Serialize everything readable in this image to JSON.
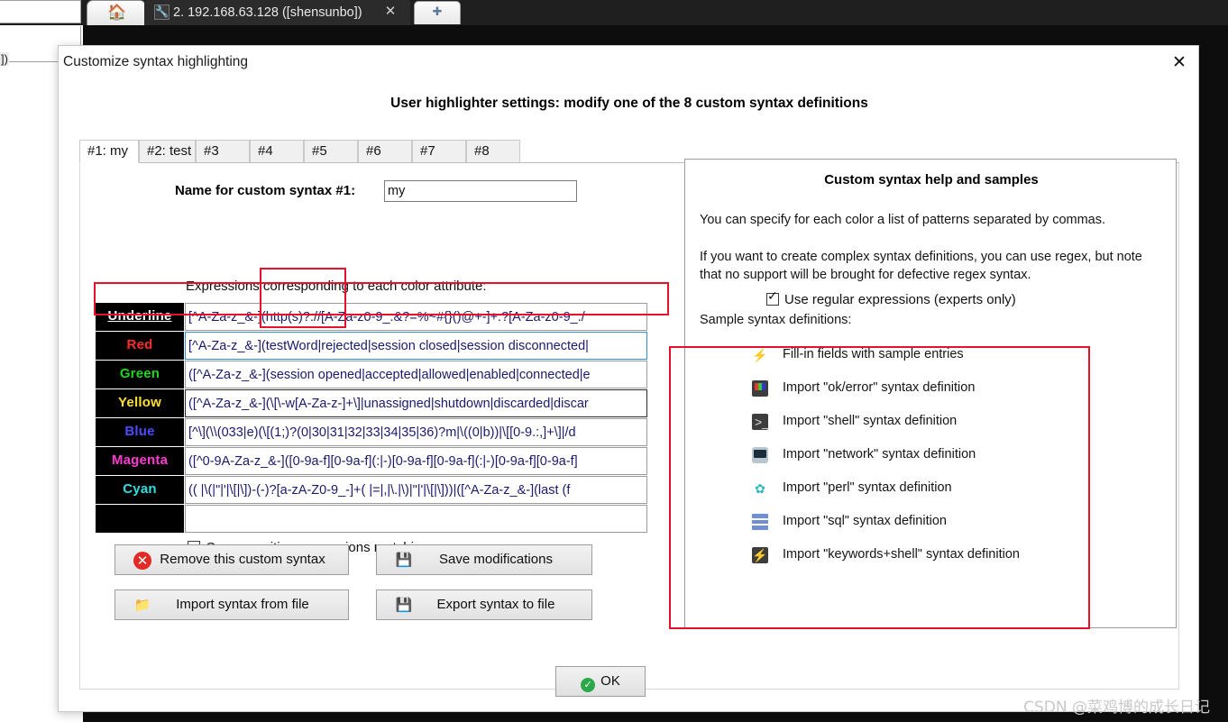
{
  "background_app": {
    "home_tab_icon": "home-icon",
    "terminal_tab": {
      "icon": "wrench-icon",
      "label": "2. 192.168.63.128 ([shensunbo])",
      "close_icon": "close-icon"
    },
    "new_tab_icon": "plus-icon",
    "side_text": "])"
  },
  "dialog": {
    "title": "Customize syntax highlighting",
    "close_icon": "close-icon",
    "heading": "User highlighter settings: modify one of the 8 custom syntax definitions",
    "tabs": [
      {
        "label": "#1: my",
        "active": true
      },
      {
        "label": "#2: test",
        "active": false
      },
      {
        "label": "#3",
        "active": false
      },
      {
        "label": "#4",
        "active": false
      },
      {
        "label": "#5",
        "active": false
      },
      {
        "label": "#6",
        "active": false
      },
      {
        "label": "#7",
        "active": false
      },
      {
        "label": "#8",
        "active": false
      }
    ],
    "name_field": {
      "label": "Name for custom syntax #1:",
      "value": "my",
      "placeholder": ""
    },
    "expressions_caption": "Expressions corresponding to each color attribute:",
    "rows": [
      {
        "attribute": "Underline",
        "color": "#ffffff",
        "underlined": true,
        "value": "[^A-Za-z_&-](http(s)?://[A-Za-z0-9_.&?=%~#{}()@+-]+:?[A-Za-z0-9_./"
      },
      {
        "attribute": "Red",
        "color": "#ff2b2b",
        "underlined": false,
        "focused": true,
        "value": "[^A-Za-z_&-](testWord|rejected|session closed|session disconnected|"
      },
      {
        "attribute": "Green",
        "color": "#21d421",
        "underlined": false,
        "value": "([^A-Za-z_&-](session opened|accepted|allowed|enabled|connected|e"
      },
      {
        "attribute": "Yellow",
        "color": "#ffe12b",
        "underlined": false,
        "value": "([^A-Za-z_&-](\\[\\-w[A-Za-z-]+\\]|unassigned|shutdown|discarded|discar"
      },
      {
        "attribute": "Blue",
        "color": "#4b4bff",
        "underlined": false,
        "value": "[^\\](\\\\(033|e)(\\[(1;)?(0|30|31|32|33|34|35|36)?m|\\((0|b))|\\[[0-9.:,]+\\]|/d"
      },
      {
        "attribute": "Magenta",
        "color": "#ff3ad0",
        "underlined": false,
        "value": "([^0-9A-Za-z_&-]([0-9a-f][0-9a-f](:|-)[0-9a-f][0-9a-f](:|-)[0-9a-f][0-9a-f]"
      },
      {
        "attribute": "Cyan",
        "color": "#2be0e0",
        "underlined": false,
        "value": "(( |\\(|\"|'|\\[|\\])-(-)?[a-zA-Z0-9_-]+( |=|,|\\.|\\)|\"|'|\\[|\\]))|([^A-Za-z_&-](last (f"
      },
      {
        "attribute": "",
        "color": "#ffffff",
        "underlined": false,
        "value": ""
      }
    ],
    "case_sensitive": {
      "label": "Case-sensitive expressions matching",
      "checked": false
    },
    "buttons": [
      {
        "id": "remove",
        "label": "Remove this custom syntax",
        "icon": "x-circle-icon"
      },
      {
        "id": "save",
        "label": "Save modifications",
        "icon": "floppy-save-icon"
      },
      {
        "id": "import",
        "label": "Import syntax from file",
        "icon": "folder-gear-icon"
      },
      {
        "id": "export",
        "label": "Export syntax to file",
        "icon": "floppy-gear-icon"
      }
    ],
    "ok_button": {
      "label": "OK",
      "icon": "check-circle-icon"
    }
  },
  "help_panel": {
    "title": "Custom syntax help and samples",
    "paragraph1": "You can specify for each color a list of patterns separated by commas.",
    "paragraph2": "If you want to create complex syntax definitions, you can use regex, but note that no support will be brought for defective regex syntax.",
    "regex_checkbox": {
      "label": "Use regular expressions (experts only)",
      "checked": true
    },
    "samples_title": "Sample syntax definitions:",
    "samples": [
      {
        "label": "Fill-in fields with sample entries",
        "icon": "bolt-icon",
        "icon_class": "ic-bolt",
        "glyph": "⚡"
      },
      {
        "label": "Import \"ok/error\" syntax definition",
        "icon": "monitor-icon",
        "icon_class": "ic-monitor",
        "glyph": ""
      },
      {
        "label": "Import \"shell\" syntax definition",
        "icon": "shell-icon",
        "icon_class": "ic-shell",
        "glyph": ">_"
      },
      {
        "label": "Import \"network\" syntax definition",
        "icon": "network-icon",
        "icon_class": "ic-network",
        "glyph": ""
      },
      {
        "label": "Import \"perl\" syntax definition",
        "icon": "gear-icon",
        "icon_class": "ic-gear",
        "glyph": "✿"
      },
      {
        "label": "Import \"sql\" syntax definition",
        "icon": "database-icon",
        "icon_class": "ic-sql",
        "glyph": ""
      },
      {
        "label": "Import \"keywords+shell\" syntax definition",
        "icon": "keywords-shell-icon",
        "icon_class": "ic-kws",
        "glyph": "⚡"
      }
    ]
  },
  "watermark": "CSDN @菜鸡博的成长日记",
  "colors": {
    "annotation_red": "#e8112d",
    "focus_blue": "#2f8fd8",
    "dialog_bg": "#ffffff",
    "terminal_bg": "#0d0d0d"
  }
}
